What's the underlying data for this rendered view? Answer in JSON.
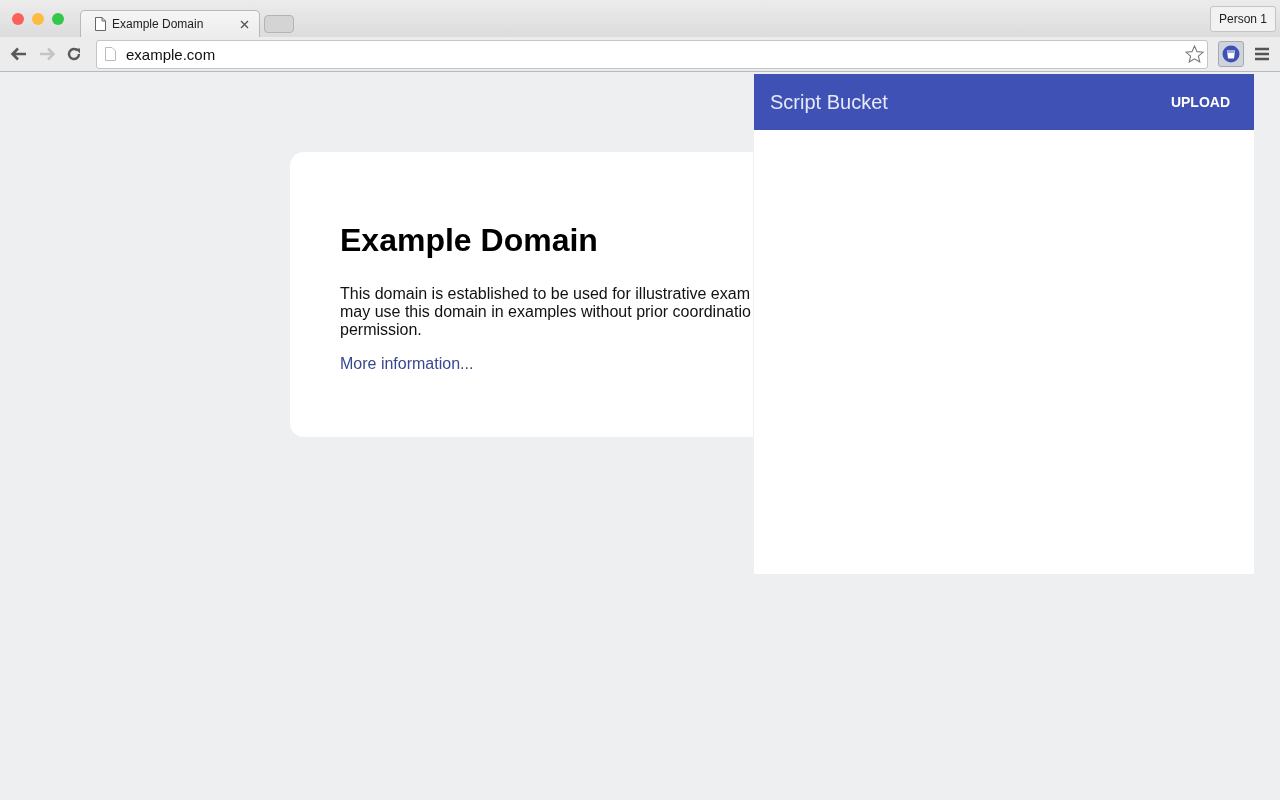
{
  "tab": {
    "title": "Example Domain",
    "selected": true
  },
  "profile_button": "Person 1",
  "address_bar": {
    "value": "example.com"
  },
  "page": {
    "heading": "Example Domain",
    "paragraph_lines": [
      "This domain is established to be used for illustrative exam",
      "may use this domain in examples without prior coordinatio",
      "permission."
    ],
    "link": "More information..."
  },
  "popup": {
    "title": "Script Bucket",
    "action": "UPLOAD"
  }
}
